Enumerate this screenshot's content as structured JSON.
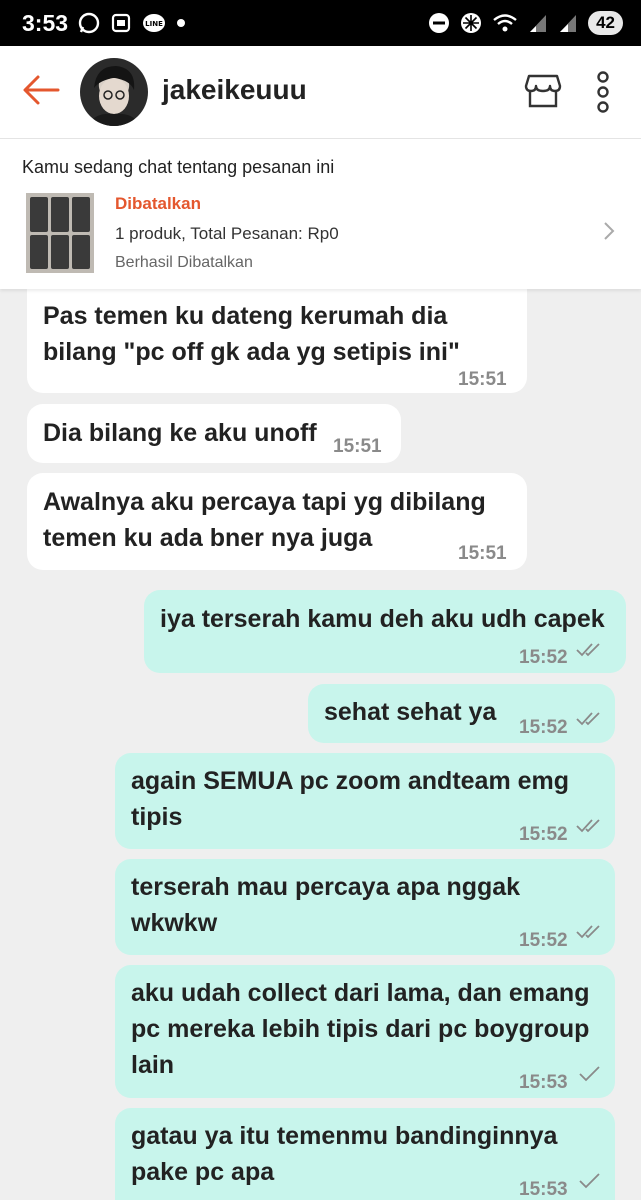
{
  "status_bar": {
    "time": "3:53",
    "battery": "42",
    "icons": [
      "whatsapp-icon",
      "screenshot-icon",
      "line-icon",
      "dot-icon",
      "dnd-icon",
      "fan-icon",
      "wifi-icon",
      "signal-icon",
      "signal-icon",
      "battery-icon"
    ]
  },
  "header": {
    "username": "jakeikeuuu",
    "icons": [
      "back-arrow-icon",
      "store-icon",
      "more-vertical-icon"
    ],
    "accent": "#e4572e"
  },
  "order": {
    "caption": "Kamu sedang chat tentang pesanan ini",
    "status": "Dibatalkan",
    "summary": "1 produk, Total Pesanan: Rp0",
    "note": "Berhasil Dibatalkan"
  },
  "messages": [
    {
      "side": "in",
      "lines": [
        "Pas temen ku dateng kerumah dia",
        "bilang \"pc off gk ada yg setipis ini\""
      ],
      "time": "15:51"
    },
    {
      "side": "in",
      "lines": [
        "Dia bilang ke aku unoff"
      ],
      "time": "15:51"
    },
    {
      "side": "in",
      "lines": [
        "Awalnya aku percaya tapi yg dibilang",
        "temen ku ada bner nya juga"
      ],
      "time": "15:51"
    },
    {
      "side": "out",
      "lines": [
        "iya terserah kamu deh aku udh capek"
      ],
      "time": "15:52",
      "status": "read"
    },
    {
      "side": "out",
      "lines": [
        "sehat sehat ya"
      ],
      "time": "15:52",
      "status": "read"
    },
    {
      "side": "out",
      "lines": [
        "again SEMUA pc zoom andteam emg",
        "tipis"
      ],
      "time": "15:52",
      "status": "read"
    },
    {
      "side": "out",
      "lines": [
        "terserah mau percaya apa nggak",
        "wkwkw"
      ],
      "time": "15:52",
      "status": "read"
    },
    {
      "side": "out",
      "lines": [
        "aku udah collect dari lama, dan emang",
        "pc mereka lebih tipis dari pc boygroup",
        "lain"
      ],
      "time": "15:53",
      "status": "sent"
    },
    {
      "side": "out",
      "lines": [
        "gatau ya itu temenmu bandinginnya",
        "pake pc apa"
      ],
      "time": "15:53",
      "status": "sent"
    }
  ],
  "colors": {
    "incoming": "#ffffff",
    "outgoing": "#c8f5ec",
    "background": "#efefef"
  }
}
